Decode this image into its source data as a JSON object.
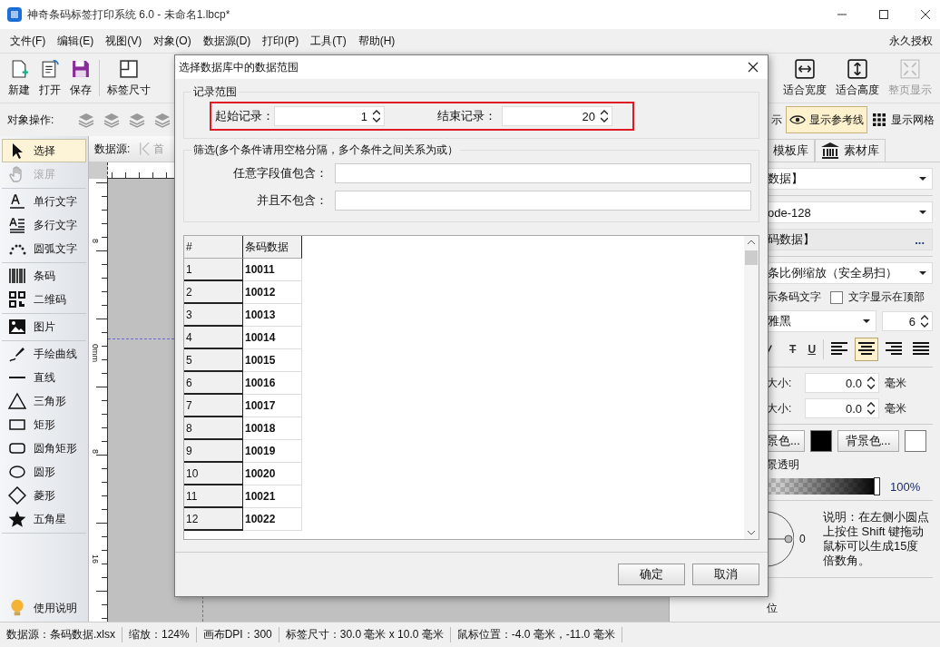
{
  "window": {
    "title": "神奇条码标签打印系统 6.0 - 未命名1.lbcp*"
  },
  "menu": [
    "文件(F)",
    "编辑(E)",
    "视图(V)",
    "对象(O)",
    "数据源(D)",
    "打印(P)",
    "工具(T)",
    "帮助(H)"
  ],
  "license": "永久授权",
  "toolbar_left": [
    {
      "label": "新建",
      "disabled": false
    },
    {
      "label": "打开",
      "disabled": false
    },
    {
      "label": "保存",
      "disabled": false
    },
    {
      "label": "标签尺寸",
      "disabled": false
    }
  ],
  "toolbar_right": [
    {
      "label": "适合宽度",
      "disabled": false
    },
    {
      "label": "适合高度",
      "disabled": false
    },
    {
      "label": "整页显示",
      "disabled": true
    }
  ],
  "object_ops": {
    "label": "对象操作:"
  },
  "view_toggles": [
    {
      "label": "示",
      "selected": false
    },
    {
      "label": "显示参考线",
      "selected": true
    },
    {
      "label": "显示网格",
      "selected": false
    }
  ],
  "tools": [
    [
      {
        "label": "选择",
        "selected": true,
        "disabled": false
      },
      {
        "label": "滚屏",
        "selected": false,
        "disabled": true
      }
    ],
    [
      {
        "label": "单行文字",
        "selected": false,
        "disabled": false
      },
      {
        "label": "多行文字",
        "selected": false,
        "disabled": false
      },
      {
        "label": "圆弧文字",
        "selected": false,
        "disabled": false
      }
    ],
    [
      {
        "label": "条码",
        "selected": false,
        "disabled": false
      },
      {
        "label": "二维码",
        "selected": false,
        "disabled": false
      }
    ],
    [
      {
        "label": "图片",
        "selected": false,
        "disabled": false
      }
    ],
    [
      {
        "label": "手绘曲线",
        "selected": false,
        "disabled": false
      },
      {
        "label": "直线",
        "selected": false,
        "disabled": false
      },
      {
        "label": "三角形",
        "selected": false,
        "disabled": false
      },
      {
        "label": "矩形",
        "selected": false,
        "disabled": false
      },
      {
        "label": "圆角矩形",
        "selected": false,
        "disabled": false
      },
      {
        "label": "圆形",
        "selected": false,
        "disabled": false
      },
      {
        "label": "菱形",
        "selected": false,
        "disabled": false
      },
      {
        "label": "五角星",
        "selected": false,
        "disabled": false
      }
    ]
  ],
  "help": "使用说明",
  "canvas_bar": {
    "label": "数据源:",
    "button": "首"
  },
  "ruler_labels": [
    "8",
    "0mm",
    "8",
    "16"
  ],
  "right_panel": {
    "tabs": [
      {
        "label": "模板库",
        "selected": false
      },
      {
        "label": "素材库",
        "selected": false
      }
    ],
    "data_select": "数据】",
    "symbology": "ode-128",
    "content": "码数据】",
    "content_button": "...",
    "scaling": "条比例缩放（安全易扫）",
    "show_text": "示条码文字",
    "text_on_top": {
      "label": "文字显示在顶部",
      "checked": false
    },
    "font": "雅黑",
    "font_size": "6",
    "styles": [
      {
        "label": "T",
        "selected": false
      },
      {
        "label": "U",
        "selected": false
      }
    ],
    "align": [
      {
        "selected": false
      },
      {
        "selected": true
      },
      {
        "selected": false
      },
      {
        "selected": false
      }
    ],
    "sizes": [
      {
        "label": "大小:",
        "value": "0.0",
        "unit": "毫米"
      },
      {
        "label": "大小:",
        "value": "0.0",
        "unit": "毫米"
      }
    ],
    "colors": [
      {
        "label": "景色...",
        "color": "#000000"
      },
      {
        "label": "背景色...",
        "color": "#ffffff"
      }
    ],
    "transparency": {
      "label": "景透明",
      "level": 1,
      "reading": "100%"
    },
    "angle": "0",
    "note": "说明：在左侧小圆点上按住 Shift 键拖动鼠标可以生成15度倍数角。",
    "footer": "位"
  },
  "dialog": {
    "title": "选择数据库中的数据范围",
    "range": {
      "title": "记录范围",
      "start": {
        "label": "起始记录：",
        "value": "1"
      },
      "end": {
        "label": "结束记录：",
        "value": "20"
      }
    },
    "filter": {
      "title": "筛选(多个条件请用空格分隔，多个条件之间关系为或）",
      "fields": [
        "任意字段值包含：",
        "并且不包含："
      ]
    },
    "table": {
      "columns": [
        "#",
        "条码数据"
      ],
      "rows": [
        [
          "1",
          "10011"
        ],
        [
          "2",
          "10012"
        ],
        [
          "3",
          "10013"
        ],
        [
          "4",
          "10014"
        ],
        [
          "5",
          "10015"
        ],
        [
          "6",
          "10016"
        ],
        [
          "7",
          "10017"
        ],
        [
          "8",
          "10018"
        ],
        [
          "9",
          "10019"
        ],
        [
          "10",
          "10020"
        ],
        [
          "11",
          "10021"
        ],
        [
          "12",
          "10022"
        ]
      ]
    },
    "buttons": [
      "确定",
      "取消"
    ]
  },
  "status_bar": [
    "数据源：条码数据.xlsx",
    "缩放：124%",
    "画布DPI：300",
    "标签尺寸：30.0 毫米 x 10.0 毫米",
    "鼠标位置：-4.0 毫米，-11.0 毫米"
  ]
}
